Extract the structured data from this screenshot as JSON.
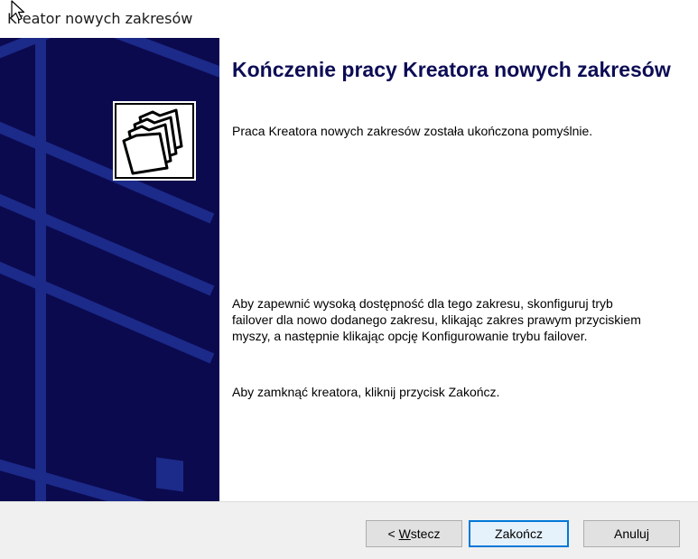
{
  "window": {
    "title": "Kreator nowych zakresów"
  },
  "banner": {
    "background_color": "#0b0a4e",
    "icon": "folders-icon"
  },
  "content": {
    "heading": "Kończenie pracy Kreatora nowych zakresów",
    "intro": "Praca Kreatora nowych zakresów została ukończona pomyślnie.",
    "failover_note": "Aby zapewnić wysoką dostępność dla tego zakresu, skonfiguruj tryb failover dla nowo dodanego zakresu, klikając zakres prawym przyciskiem myszy, a następnie klikając opcję Konfigurowanie trybu failover.",
    "close_instruction": "Aby zamknąć kreatora, kliknij przycisk Zakończ."
  },
  "footer": {
    "back_prefix": "< ",
    "back_accel": "W",
    "back_rest": "stecz",
    "finish_label": "Zakończ",
    "cancel_label": "Anuluj"
  },
  "colors": {
    "heading": "#0c0c55",
    "accent_focus": "#0078d7"
  }
}
